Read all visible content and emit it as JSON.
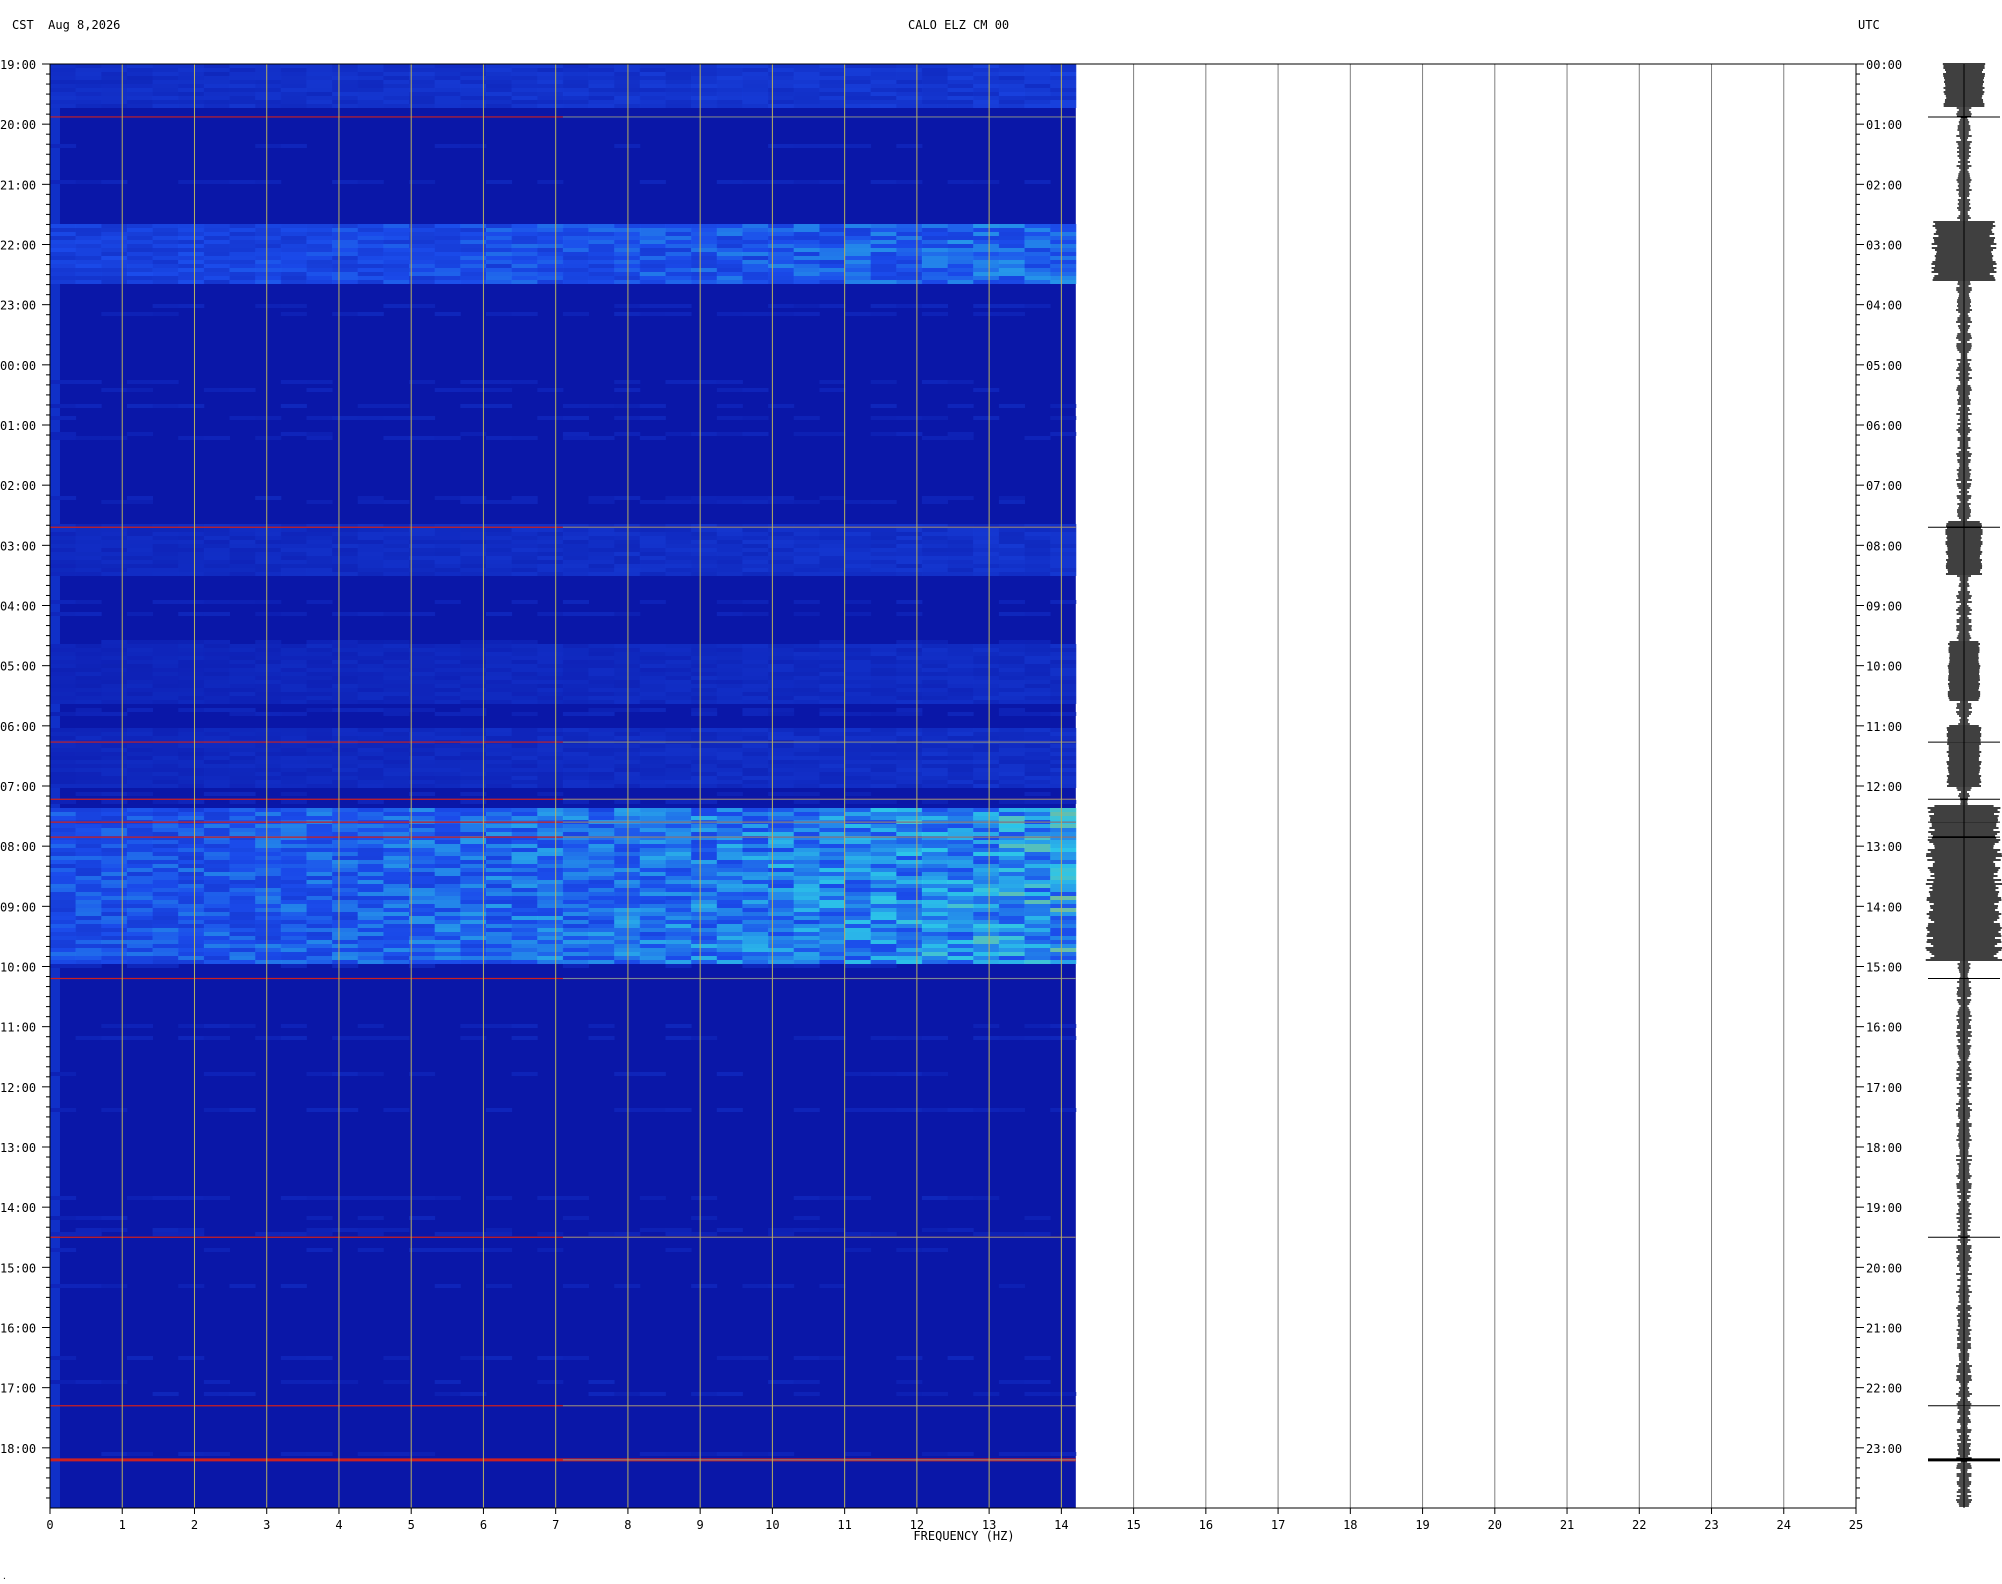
{
  "header": {
    "left_tz": "CST",
    "date": "Aug 8,2026",
    "station": "CALO ELZ CM 00",
    "right_tz": "UTC"
  },
  "chart_data": {
    "type": "heatmap",
    "title": "CALO ELZ CM 00",
    "xlabel": "FREQUENCY (HZ)",
    "xlim": [
      0,
      25
    ],
    "x_ticks": [
      "0",
      "1",
      "2",
      "3",
      "4",
      "5",
      "6",
      "7",
      "8",
      "9",
      "10",
      "11",
      "12",
      "13",
      "14",
      "15",
      "16",
      "17",
      "18",
      "19",
      "20",
      "21",
      "22",
      "23",
      "24",
      "25"
    ],
    "data_extent_hz": 14.2,
    "ylim_hours": [
      0,
      24
    ],
    "left_time_labels": [
      "19:00",
      "20:00",
      "21:00",
      "22:00",
      "23:00",
      "00:00",
      "01:00",
      "02:00",
      "03:00",
      "04:00",
      "05:00",
      "06:00",
      "07:00",
      "08:00",
      "09:00",
      "10:00",
      "11:00",
      "12:00",
      "13:00",
      "14:00",
      "15:00",
      "16:00",
      "17:00",
      "18:00"
    ],
    "right_time_labels": [
      "00:00",
      "01:00",
      "02:00",
      "03:00",
      "04:00",
      "05:00",
      "06:00",
      "07:00",
      "08:00",
      "09:00",
      "10:00",
      "11:00",
      "12:00",
      "13:00",
      "14:00",
      "15:00",
      "16:00",
      "17:00",
      "18:00",
      "19:00",
      "20:00",
      "21:00",
      "22:00",
      "23:00"
    ],
    "energy_bands_hours": [
      {
        "start": 0.0,
        "end": 0.7,
        "level": 0.35
      },
      {
        "start": 2.6,
        "end": 3.6,
        "level": 0.65
      },
      {
        "start": 7.6,
        "end": 8.5,
        "level": 0.28
      },
      {
        "start": 9.6,
        "end": 10.6,
        "level": 0.22
      },
      {
        "start": 11.0,
        "end": 12.0,
        "level": 0.25
      },
      {
        "start": 12.3,
        "end": 14.9,
        "level": 0.8
      }
    ],
    "spike_lines_hours": [
      0.88,
      7.7,
      11.27,
      12.22,
      12.6,
      12.85,
      15.2,
      19.5,
      22.3,
      23.2
    ],
    "colors": {
      "background": "#0a17a8",
      "mid": "#1d52f2",
      "hot": "#30d8f0",
      "warm": "#f0c020",
      "spike": "#cc2020",
      "grid": "#b8b060",
      "empty_grid": "#808080",
      "waveform": "#000000"
    }
  }
}
